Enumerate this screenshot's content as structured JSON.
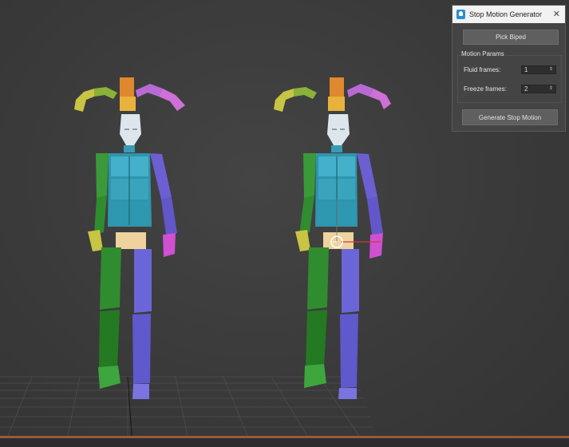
{
  "dialog": {
    "title": "Stop Motion Generator",
    "close_glyph": "✕",
    "pick_button": "Pick Biped",
    "group_label": "Motion Params",
    "fluid_label": "Fluid frames:",
    "fluid_value": "1",
    "freeze_label": "Freeze frames:",
    "freeze_value": "2",
    "generate_button": "Generate Stop Motion",
    "spinner_glyph": "⇕"
  },
  "viewport": {
    "background_color": "#3b3b3b",
    "grid_color": "#555555",
    "timeline_color": "#9a5a3c"
  }
}
